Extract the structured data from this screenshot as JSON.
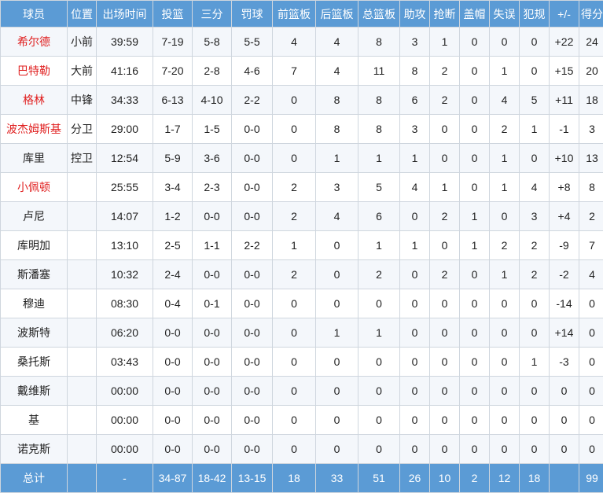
{
  "colors": {
    "header_bg": "#5b9bd5",
    "starter_name": "#e02020",
    "text": "#222222"
  },
  "headers": [
    "球员",
    "位置",
    "出场时间",
    "投篮",
    "三分",
    "罚球",
    "前篮板",
    "后篮板",
    "总篮板",
    "助攻",
    "抢断",
    "盖帽",
    "失误",
    "犯规",
    "+/-",
    "得分"
  ],
  "players": [
    {
      "name": "希尔德",
      "starter": true,
      "cells": [
        "小前",
        "39:59",
        "7-19",
        "5-8",
        "5-5",
        "4",
        "4",
        "8",
        "3",
        "1",
        "0",
        "0",
        "0",
        "+22",
        "24"
      ]
    },
    {
      "name": "巴特勒",
      "starter": true,
      "cells": [
        "大前",
        "41:16",
        "7-20",
        "2-8",
        "4-6",
        "7",
        "4",
        "11",
        "8",
        "2",
        "0",
        "1",
        "0",
        "+15",
        "20"
      ]
    },
    {
      "name": "格林",
      "starter": true,
      "cells": [
        "中锋",
        "34:33",
        "6-13",
        "4-10",
        "2-2",
        "0",
        "8",
        "8",
        "6",
        "2",
        "0",
        "4",
        "5",
        "+11",
        "18"
      ]
    },
    {
      "name": "波杰姆斯基",
      "starter": true,
      "cells": [
        "分卫",
        "29:00",
        "1-7",
        "1-5",
        "0-0",
        "0",
        "8",
        "8",
        "3",
        "0",
        "0",
        "2",
        "1",
        "-1",
        "3"
      ]
    },
    {
      "name": "库里",
      "starter": false,
      "cells": [
        "控卫",
        "12:54",
        "5-9",
        "3-6",
        "0-0",
        "0",
        "1",
        "1",
        "1",
        "0",
        "0",
        "1",
        "0",
        "+10",
        "13"
      ]
    },
    {
      "name": "小佩顿",
      "starter": true,
      "cells": [
        "",
        "25:55",
        "3-4",
        "2-3",
        "0-0",
        "2",
        "3",
        "5",
        "4",
        "1",
        "0",
        "1",
        "4",
        "+8",
        "8"
      ]
    },
    {
      "name": "卢尼",
      "starter": false,
      "cells": [
        "",
        "14:07",
        "1-2",
        "0-0",
        "0-0",
        "2",
        "4",
        "6",
        "0",
        "2",
        "1",
        "0",
        "3",
        "+4",
        "2"
      ]
    },
    {
      "name": "库明加",
      "starter": false,
      "cells": [
        "",
        "13:10",
        "2-5",
        "1-1",
        "2-2",
        "1",
        "0",
        "1",
        "1",
        "0",
        "1",
        "2",
        "2",
        "-9",
        "7"
      ]
    },
    {
      "name": "斯潘塞",
      "starter": false,
      "cells": [
        "",
        "10:32",
        "2-4",
        "0-0",
        "0-0",
        "2",
        "0",
        "2",
        "0",
        "2",
        "0",
        "1",
        "2",
        "-2",
        "4"
      ]
    },
    {
      "name": "穆迪",
      "starter": false,
      "cells": [
        "",
        "08:30",
        "0-4",
        "0-1",
        "0-0",
        "0",
        "0",
        "0",
        "0",
        "0",
        "0",
        "0",
        "0",
        "-14",
        "0"
      ]
    },
    {
      "name": "波斯特",
      "starter": false,
      "cells": [
        "",
        "06:20",
        "0-0",
        "0-0",
        "0-0",
        "0",
        "1",
        "1",
        "0",
        "0",
        "0",
        "0",
        "0",
        "+14",
        "0"
      ]
    },
    {
      "name": "桑托斯",
      "starter": false,
      "cells": [
        "",
        "03:43",
        "0-0",
        "0-0",
        "0-0",
        "0",
        "0",
        "0",
        "0",
        "0",
        "0",
        "0",
        "1",
        "-3",
        "0"
      ]
    },
    {
      "name": "戴维斯",
      "starter": false,
      "cells": [
        "",
        "00:00",
        "0-0",
        "0-0",
        "0-0",
        "0",
        "0",
        "0",
        "0",
        "0",
        "0",
        "0",
        "0",
        "0",
        "0"
      ]
    },
    {
      "name": "基",
      "starter": false,
      "cells": [
        "",
        "00:00",
        "0-0",
        "0-0",
        "0-0",
        "0",
        "0",
        "0",
        "0",
        "0",
        "0",
        "0",
        "0",
        "0",
        "0"
      ]
    },
    {
      "name": "诺克斯",
      "starter": false,
      "cells": [
        "",
        "00:00",
        "0-0",
        "0-0",
        "0-0",
        "0",
        "0",
        "0",
        "0",
        "0",
        "0",
        "0",
        "0",
        "0",
        "0"
      ]
    }
  ],
  "total": {
    "label": "总计",
    "cells": [
      "",
      "-",
      "34-87",
      "18-42",
      "13-15",
      "18",
      "33",
      "51",
      "26",
      "10",
      "2",
      "12",
      "18",
      "",
      "99"
    ]
  }
}
